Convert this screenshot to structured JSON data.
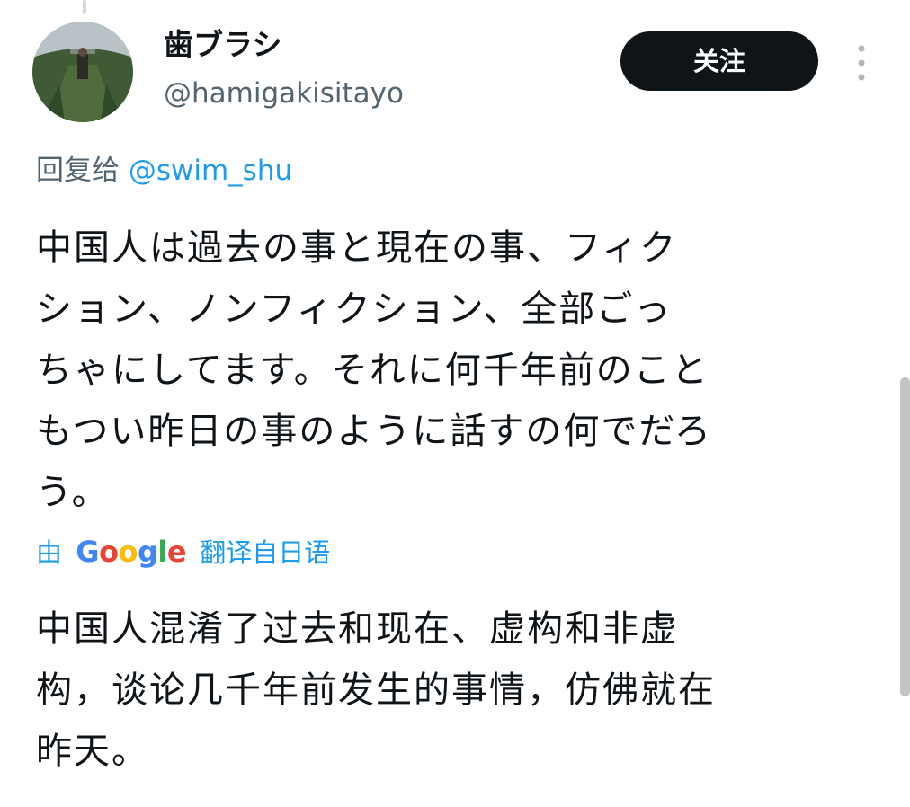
{
  "user": {
    "display_name": "歯ブラシ",
    "handle": "@hamigakisitayo",
    "follow_label": "关注"
  },
  "reply": {
    "prefix": "回复给",
    "to_handle": "@swim_shu"
  },
  "tweet": {
    "lines": [
      "中国人は過去の事と現在の事、フィク",
      "ション、ノンフィクション、全部ごっ",
      "ちゃにしてます。それに何千年前のこと",
      "もつい昨日の事のように話すの何でだろ",
      "う。"
    ]
  },
  "translation": {
    "prefix": "由",
    "logo_letters": [
      "G",
      "o",
      "o",
      "g",
      "l",
      "e"
    ],
    "logo_colors": [
      "#4285F4",
      "#EA4335",
      "#FBBC05",
      "#4285F4",
      "#34A853",
      "#EA4335"
    ],
    "suffix": "翻译自日语",
    "lines": [
      "中国人混淆了过去和现在、虚构和非虚",
      "构，谈论几千年前发生的事情，仿佛就在",
      "昨天。"
    ]
  },
  "icons": {
    "more": "more-vertical-icon"
  },
  "colors": {
    "accent": "#1d9bf0",
    "secondary_text": "#536471",
    "primary_text": "#0f1419",
    "follow_bg": "#0f1419"
  }
}
